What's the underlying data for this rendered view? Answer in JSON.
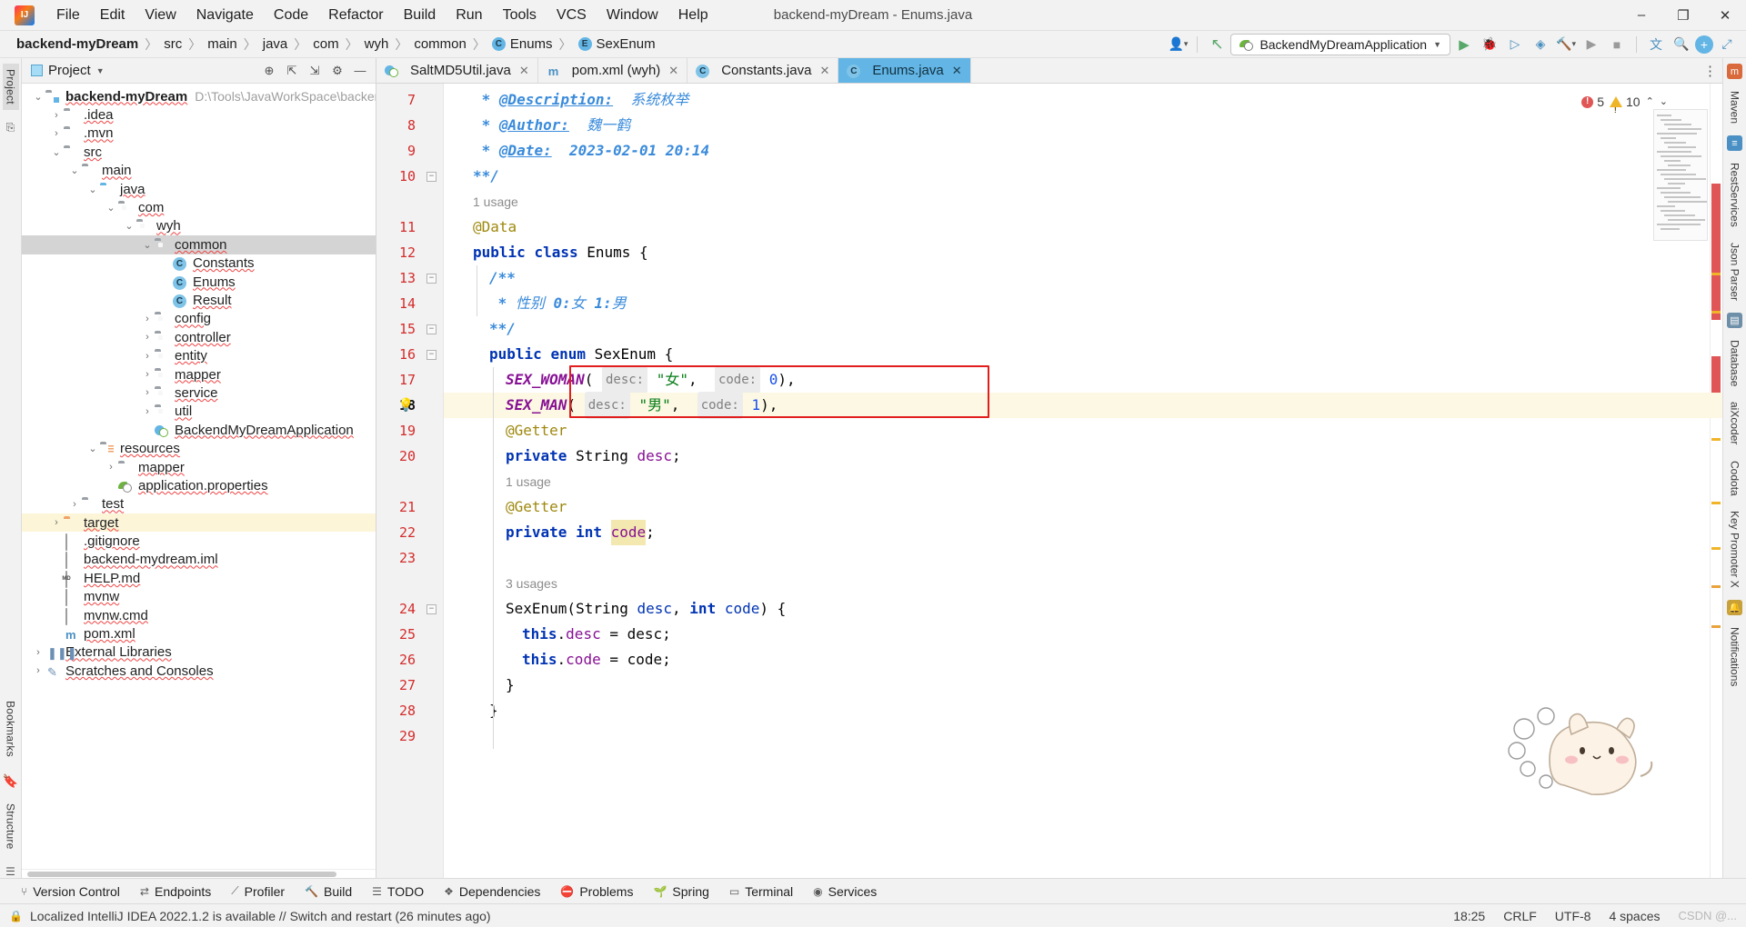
{
  "titlebar": {
    "logo_icon": "intellij-logo",
    "window_title": "backend-myDream - Enums.java",
    "menus": [
      {
        "label": "File"
      },
      {
        "label": "Edit"
      },
      {
        "label": "View"
      },
      {
        "label": "Navigate"
      },
      {
        "label": "Code"
      },
      {
        "label": "Refactor"
      },
      {
        "label": "Build"
      },
      {
        "label": "Run"
      },
      {
        "label": "Tools"
      },
      {
        "label": "VCS"
      },
      {
        "label": "Window"
      },
      {
        "label": "Help"
      }
    ],
    "minimize": "–",
    "maximize": "❐",
    "close": "✕"
  },
  "navbar": {
    "crumbs": [
      {
        "label": "backend-myDream",
        "bold": true,
        "badge": null
      },
      {
        "label": "src",
        "bold": false,
        "badge": null
      },
      {
        "label": "main",
        "bold": false,
        "badge": null
      },
      {
        "label": "java",
        "bold": false,
        "badge": null
      },
      {
        "label": "com",
        "bold": false,
        "badge": null
      },
      {
        "label": "wyh",
        "bold": false,
        "badge": null
      },
      {
        "label": "common",
        "bold": false,
        "badge": null
      },
      {
        "label": "Enums",
        "bold": false,
        "badge": "C"
      },
      {
        "label": "SexEnum",
        "bold": false,
        "badge": "E"
      }
    ],
    "separator": "〉",
    "run_config": "BackendMyDreamApplication",
    "icons": {
      "user": "👤",
      "updates": "↖",
      "run": "▶",
      "debug": "🐞",
      "run_coverage": "▷",
      "profiler": "⚙",
      "build_hammer": "🔨",
      "stop": "■",
      "translate": "文",
      "search": "🔍",
      "plus": "+",
      "expand": "⇲"
    }
  },
  "left_rail": {
    "tabs": [
      {
        "label": "Project",
        "active": true
      },
      {
        "label": "Bookmarks",
        "active": false
      }
    ],
    "structure_label": "Structure"
  },
  "project_panel": {
    "title": "Project",
    "header_icons": [
      "locate-icon",
      "collapse-all-icon",
      "expand-icon",
      "settings-gear-icon",
      "hide-icon"
    ],
    "tree": [
      {
        "depth": 0,
        "twisty": "v",
        "icon": "module",
        "label": "backend-myDream",
        "bold": true,
        "path": "D:\\Tools\\JavaWorkSpace\\backend-my",
        "state": "normal"
      },
      {
        "depth": 1,
        "twisty": ">",
        "icon": "folder",
        "label": ".idea",
        "state": "normal"
      },
      {
        "depth": 1,
        "twisty": ">",
        "icon": "folder",
        "label": ".mvn",
        "state": "normal"
      },
      {
        "depth": 1,
        "twisty": "v",
        "icon": "folder",
        "label": "src",
        "state": "normal"
      },
      {
        "depth": 2,
        "twisty": "v",
        "icon": "folder",
        "label": "main",
        "state": "normal"
      },
      {
        "depth": 3,
        "twisty": "v",
        "icon": "folder-blue",
        "label": "java",
        "state": "normal"
      },
      {
        "depth": 4,
        "twisty": "v",
        "icon": "package",
        "label": "com",
        "state": "normal"
      },
      {
        "depth": 5,
        "twisty": "v",
        "icon": "package",
        "label": "wyh",
        "state": "normal"
      },
      {
        "depth": 6,
        "twisty": "v",
        "icon": "package",
        "label": "common",
        "state": "selected"
      },
      {
        "depth": 7,
        "twisty": "",
        "icon": "class",
        "label": "Constants",
        "state": "normal"
      },
      {
        "depth": 7,
        "twisty": "",
        "icon": "class",
        "label": "Enums",
        "state": "normal"
      },
      {
        "depth": 7,
        "twisty": "",
        "icon": "class",
        "label": "Result",
        "state": "normal"
      },
      {
        "depth": 6,
        "twisty": ">",
        "icon": "package",
        "label": "config",
        "state": "normal"
      },
      {
        "depth": 6,
        "twisty": ">",
        "icon": "package",
        "label": "controller",
        "state": "normal"
      },
      {
        "depth": 6,
        "twisty": ">",
        "icon": "package",
        "label": "entity",
        "state": "normal"
      },
      {
        "depth": 6,
        "twisty": ">",
        "icon": "package",
        "label": "mapper",
        "state": "normal"
      },
      {
        "depth": 6,
        "twisty": ">",
        "icon": "package",
        "label": "service",
        "state": "normal"
      },
      {
        "depth": 6,
        "twisty": ">",
        "icon": "package",
        "label": "util",
        "state": "normal"
      },
      {
        "depth": 6,
        "twisty": "",
        "icon": "spring-class",
        "label": "BackendMyDreamApplication",
        "state": "normal"
      },
      {
        "depth": 3,
        "twisty": "v",
        "icon": "resources",
        "label": "resources",
        "state": "normal"
      },
      {
        "depth": 4,
        "twisty": ">",
        "icon": "folder",
        "label": "mapper",
        "state": "normal"
      },
      {
        "depth": 4,
        "twisty": "",
        "icon": "spring-leaf",
        "label": "application.properties",
        "state": "normal"
      },
      {
        "depth": 2,
        "twisty": ">",
        "icon": "folder",
        "label": "test",
        "state": "normal"
      },
      {
        "depth": 1,
        "twisty": ">",
        "icon": "folder-orange",
        "label": "target",
        "state": "highlight"
      },
      {
        "depth": 1,
        "twisty": "",
        "icon": "file-git",
        "label": ".gitignore",
        "state": "normal"
      },
      {
        "depth": 1,
        "twisty": "",
        "icon": "file-iml",
        "label": "backend-mydream.iml",
        "state": "normal"
      },
      {
        "depth": 1,
        "twisty": "",
        "icon": "file-md",
        "label": "HELP.md",
        "state": "normal"
      },
      {
        "depth": 1,
        "twisty": "",
        "icon": "file",
        "label": "mvnw",
        "state": "normal"
      },
      {
        "depth": 1,
        "twisty": "",
        "icon": "file",
        "label": "mvnw.cmd",
        "state": "normal"
      },
      {
        "depth": 1,
        "twisty": "",
        "icon": "maven-m",
        "label": "pom.xml",
        "state": "normal"
      },
      {
        "depth": 0,
        "twisty": ">",
        "icon": "library",
        "label": "External Libraries",
        "state": "normal"
      },
      {
        "depth": 0,
        "twisty": ">",
        "icon": "scratch",
        "label": "Scratches and Consoles",
        "state": "normal"
      }
    ]
  },
  "editor": {
    "tabs": [
      {
        "label": "SaltMD5Util.java",
        "icon": "spring-class",
        "active": false,
        "close": "✕"
      },
      {
        "label": "pom.xml (wyh)",
        "icon": "maven-m",
        "active": false,
        "close": "✕"
      },
      {
        "label": "Constants.java",
        "icon": "class",
        "active": false,
        "close": "✕"
      },
      {
        "label": "Enums.java",
        "icon": "class",
        "active": true,
        "close": "✕"
      }
    ],
    "inspections": {
      "errors": "5",
      "warnings": "10",
      "error_icon": "error-circle-icon",
      "warning_icon": "warning-triangle-icon"
    },
    "current_line": 18,
    "lines": [
      {
        "num": "7",
        "indent": 1,
        "fold": "",
        "tokens": [
          {
            "t": " * ",
            "c": "cmtb"
          },
          {
            "t": "@Description:",
            "c": "doctag"
          },
          {
            "t": "  系统枚举",
            "c": "cmt"
          }
        ]
      },
      {
        "num": "8",
        "indent": 1,
        "fold": "",
        "tokens": [
          {
            "t": " * ",
            "c": "cmtb"
          },
          {
            "t": "@Author:",
            "c": "doctag"
          },
          {
            "t": "  魏一鹤",
            "c": "cmt"
          }
        ]
      },
      {
        "num": "9",
        "indent": 1,
        "fold": "",
        "tokens": [
          {
            "t": " * ",
            "c": "cmtb"
          },
          {
            "t": "@Date:",
            "c": "doctag"
          },
          {
            "t": "  2023-02-01 20:14",
            "c": "cmtb"
          }
        ]
      },
      {
        "num": "10",
        "indent": 1,
        "fold": "-",
        "tokens": [
          {
            "t": "**/",
            "c": "cmtb"
          }
        ]
      },
      {
        "num": "",
        "indent": 1,
        "fold": "",
        "tokens": [
          {
            "t": "1 usage",
            "c": "usage"
          }
        ]
      },
      {
        "num": "11",
        "indent": 1,
        "fold": "",
        "tokens": [
          {
            "t": "@Data",
            "c": "anno"
          }
        ]
      },
      {
        "num": "12",
        "indent": 1,
        "fold": "",
        "tokens": [
          {
            "t": "public ",
            "c": "kw"
          },
          {
            "t": "class ",
            "c": "kw"
          },
          {
            "t": "Enums ",
            "c": "cls"
          },
          {
            "t": "{",
            "c": "plain"
          }
        ]
      },
      {
        "num": "13",
        "indent": 2,
        "fold": "-",
        "tokens": [
          {
            "t": "/**",
            "c": "cmtb"
          }
        ]
      },
      {
        "num": "14",
        "indent": 2,
        "fold": "",
        "tokens": [
          {
            "t": " * ",
            "c": "cmtb"
          },
          {
            "t": "性别 ",
            "c": "cmt"
          },
          {
            "t": "0:",
            "c": "cmtb"
          },
          {
            "t": "女 ",
            "c": "cmt"
          },
          {
            "t": "1:",
            "c": "cmtb"
          },
          {
            "t": "男",
            "c": "cmt"
          }
        ]
      },
      {
        "num": "15",
        "indent": 2,
        "fold": "-",
        "tokens": [
          {
            "t": "**/",
            "c": "cmtb"
          }
        ]
      },
      {
        "num": "16",
        "indent": 2,
        "fold": "-",
        "tokens": [
          {
            "t": "public ",
            "c": "kw"
          },
          {
            "t": "enum ",
            "c": "kw"
          },
          {
            "t": "SexEnum ",
            "c": "cls"
          },
          {
            "t": "{",
            "c": "plain"
          }
        ]
      },
      {
        "num": "17",
        "indent": 3,
        "fold": "",
        "tokens": [
          {
            "t": "SEX_WOMAN",
            "c": "enumc"
          },
          {
            "t": "( ",
            "c": "plain"
          },
          {
            "t": "desc:",
            "c": "hint"
          },
          {
            "t": " ",
            "c": "plain"
          },
          {
            "t": "\"女\"",
            "c": "str"
          },
          {
            "t": ",  ",
            "c": "plain"
          },
          {
            "t": "code:",
            "c": "hint"
          },
          {
            "t": " ",
            "c": "plain"
          },
          {
            "t": "0",
            "c": "num"
          },
          {
            "t": "),",
            "c": "plain"
          }
        ]
      },
      {
        "num": "18",
        "indent": 3,
        "fold": "",
        "tokens": [
          {
            "t": "SEX_MAN",
            "c": "enumc"
          },
          {
            "t": "( ",
            "c": "plain"
          },
          {
            "t": "desc:",
            "c": "hint"
          },
          {
            "t": " ",
            "c": "plain"
          },
          {
            "t": "\"男\"",
            "c": "str"
          },
          {
            "t": ",  ",
            "c": "plain"
          },
          {
            "t": "code:",
            "c": "hint"
          },
          {
            "t": " ",
            "c": "plain"
          },
          {
            "t": "1",
            "c": "num"
          },
          {
            "t": "),",
            "c": "plain"
          }
        ]
      },
      {
        "num": "19",
        "indent": 3,
        "fold": "",
        "tokens": [
          {
            "t": "@Getter",
            "c": "anno"
          }
        ]
      },
      {
        "num": "20",
        "indent": 3,
        "fold": "",
        "tokens": [
          {
            "t": "private ",
            "c": "kw"
          },
          {
            "t": "String ",
            "c": "cls"
          },
          {
            "t": "desc",
            "c": "fld"
          },
          {
            "t": ";",
            "c": "plain"
          }
        ]
      },
      {
        "num": "",
        "indent": 3,
        "fold": "",
        "tokens": [
          {
            "t": "1 usage",
            "c": "usage"
          }
        ]
      },
      {
        "num": "21",
        "indent": 3,
        "fold": "",
        "tokens": [
          {
            "t": "@Getter",
            "c": "anno"
          }
        ]
      },
      {
        "num": "22",
        "indent": 3,
        "fold": "",
        "tokens": [
          {
            "t": "private ",
            "c": "kw"
          },
          {
            "t": "int ",
            "c": "kw"
          },
          {
            "t": "code",
            "c": "fld",
            "sel": true
          },
          {
            "t": ";",
            "c": "plain"
          }
        ]
      },
      {
        "num": "23",
        "indent": 3,
        "fold": "",
        "tokens": []
      },
      {
        "num": "",
        "indent": 3,
        "fold": "",
        "tokens": [
          {
            "t": "3 usages",
            "c": "usage"
          }
        ]
      },
      {
        "num": "24",
        "indent": 3,
        "fold": "-",
        "tokens": [
          {
            "t": "SexEnum(",
            "c": "plain"
          },
          {
            "t": "String ",
            "c": "cls"
          },
          {
            "t": "desc",
            "c": "kw2"
          },
          {
            "t": ", ",
            "c": "plain"
          },
          {
            "t": "int ",
            "c": "kw"
          },
          {
            "t": "code",
            "c": "kw2"
          },
          {
            "t": ") {",
            "c": "plain"
          }
        ]
      },
      {
        "num": "25",
        "indent": 4,
        "fold": "",
        "tokens": [
          {
            "t": "this",
            "c": "kw"
          },
          {
            "t": ".",
            "c": "plain"
          },
          {
            "t": "desc",
            "c": "fld"
          },
          {
            "t": " = desc;",
            "c": "plain"
          }
        ]
      },
      {
        "num": "26",
        "indent": 4,
        "fold": "",
        "tokens": [
          {
            "t": "this",
            "c": "kw"
          },
          {
            "t": ".",
            "c": "plain"
          },
          {
            "t": "code",
            "c": "fld"
          },
          {
            "t": " = code;",
            "c": "plain"
          }
        ]
      },
      {
        "num": "27",
        "indent": 3,
        "fold": "",
        "tokens": [
          {
            "t": "}",
            "c": "plain"
          }
        ]
      },
      {
        "num": "28",
        "indent": 2,
        "fold": "",
        "tokens": [
          {
            "t": "}",
            "c": "plain"
          }
        ]
      },
      {
        "num": "29",
        "indent": 2,
        "fold": "",
        "tokens": []
      }
    ],
    "annotation_box": {
      "label": "red-highlight-box",
      "color": "#e11d1d",
      "lines": [
        17,
        18
      ]
    },
    "inlay_hints": [
      "desc:",
      "code:"
    ],
    "sticker": "cat-sticker"
  },
  "right_rail": {
    "tabs": [
      "Maven",
      "RestServices",
      "Json Parser",
      "Database",
      "aiXcoder",
      "Codota",
      "Key Promoter X",
      "Notifications"
    ]
  },
  "bottom_tools": [
    {
      "label": "Version Control",
      "icon": "branch-icon"
    },
    {
      "label": "Endpoints",
      "icon": "endpoints-icon"
    },
    {
      "label": "Profiler",
      "icon": "profiler-icon"
    },
    {
      "label": "Build",
      "icon": "hammer-icon"
    },
    {
      "label": "TODO",
      "icon": "todo-icon"
    },
    {
      "label": "Dependencies",
      "icon": "dependencies-icon"
    },
    {
      "label": "Problems",
      "icon": "problems-icon"
    },
    {
      "label": "Spring",
      "icon": "spring-icon"
    },
    {
      "label": "Terminal",
      "icon": "terminal-icon"
    },
    {
      "label": "Services",
      "icon": "services-icon"
    }
  ],
  "statusbar": {
    "message": "Localized IntelliJ IDEA 2022.1.2 is available // Switch and restart (26 minutes ago)",
    "position": "18:25",
    "line_sep": "CRLF",
    "encoding": "UTF-8",
    "indent": "4 spaces",
    "lock_icon": "lock-icon",
    "watermark": "CSDN @..."
  }
}
